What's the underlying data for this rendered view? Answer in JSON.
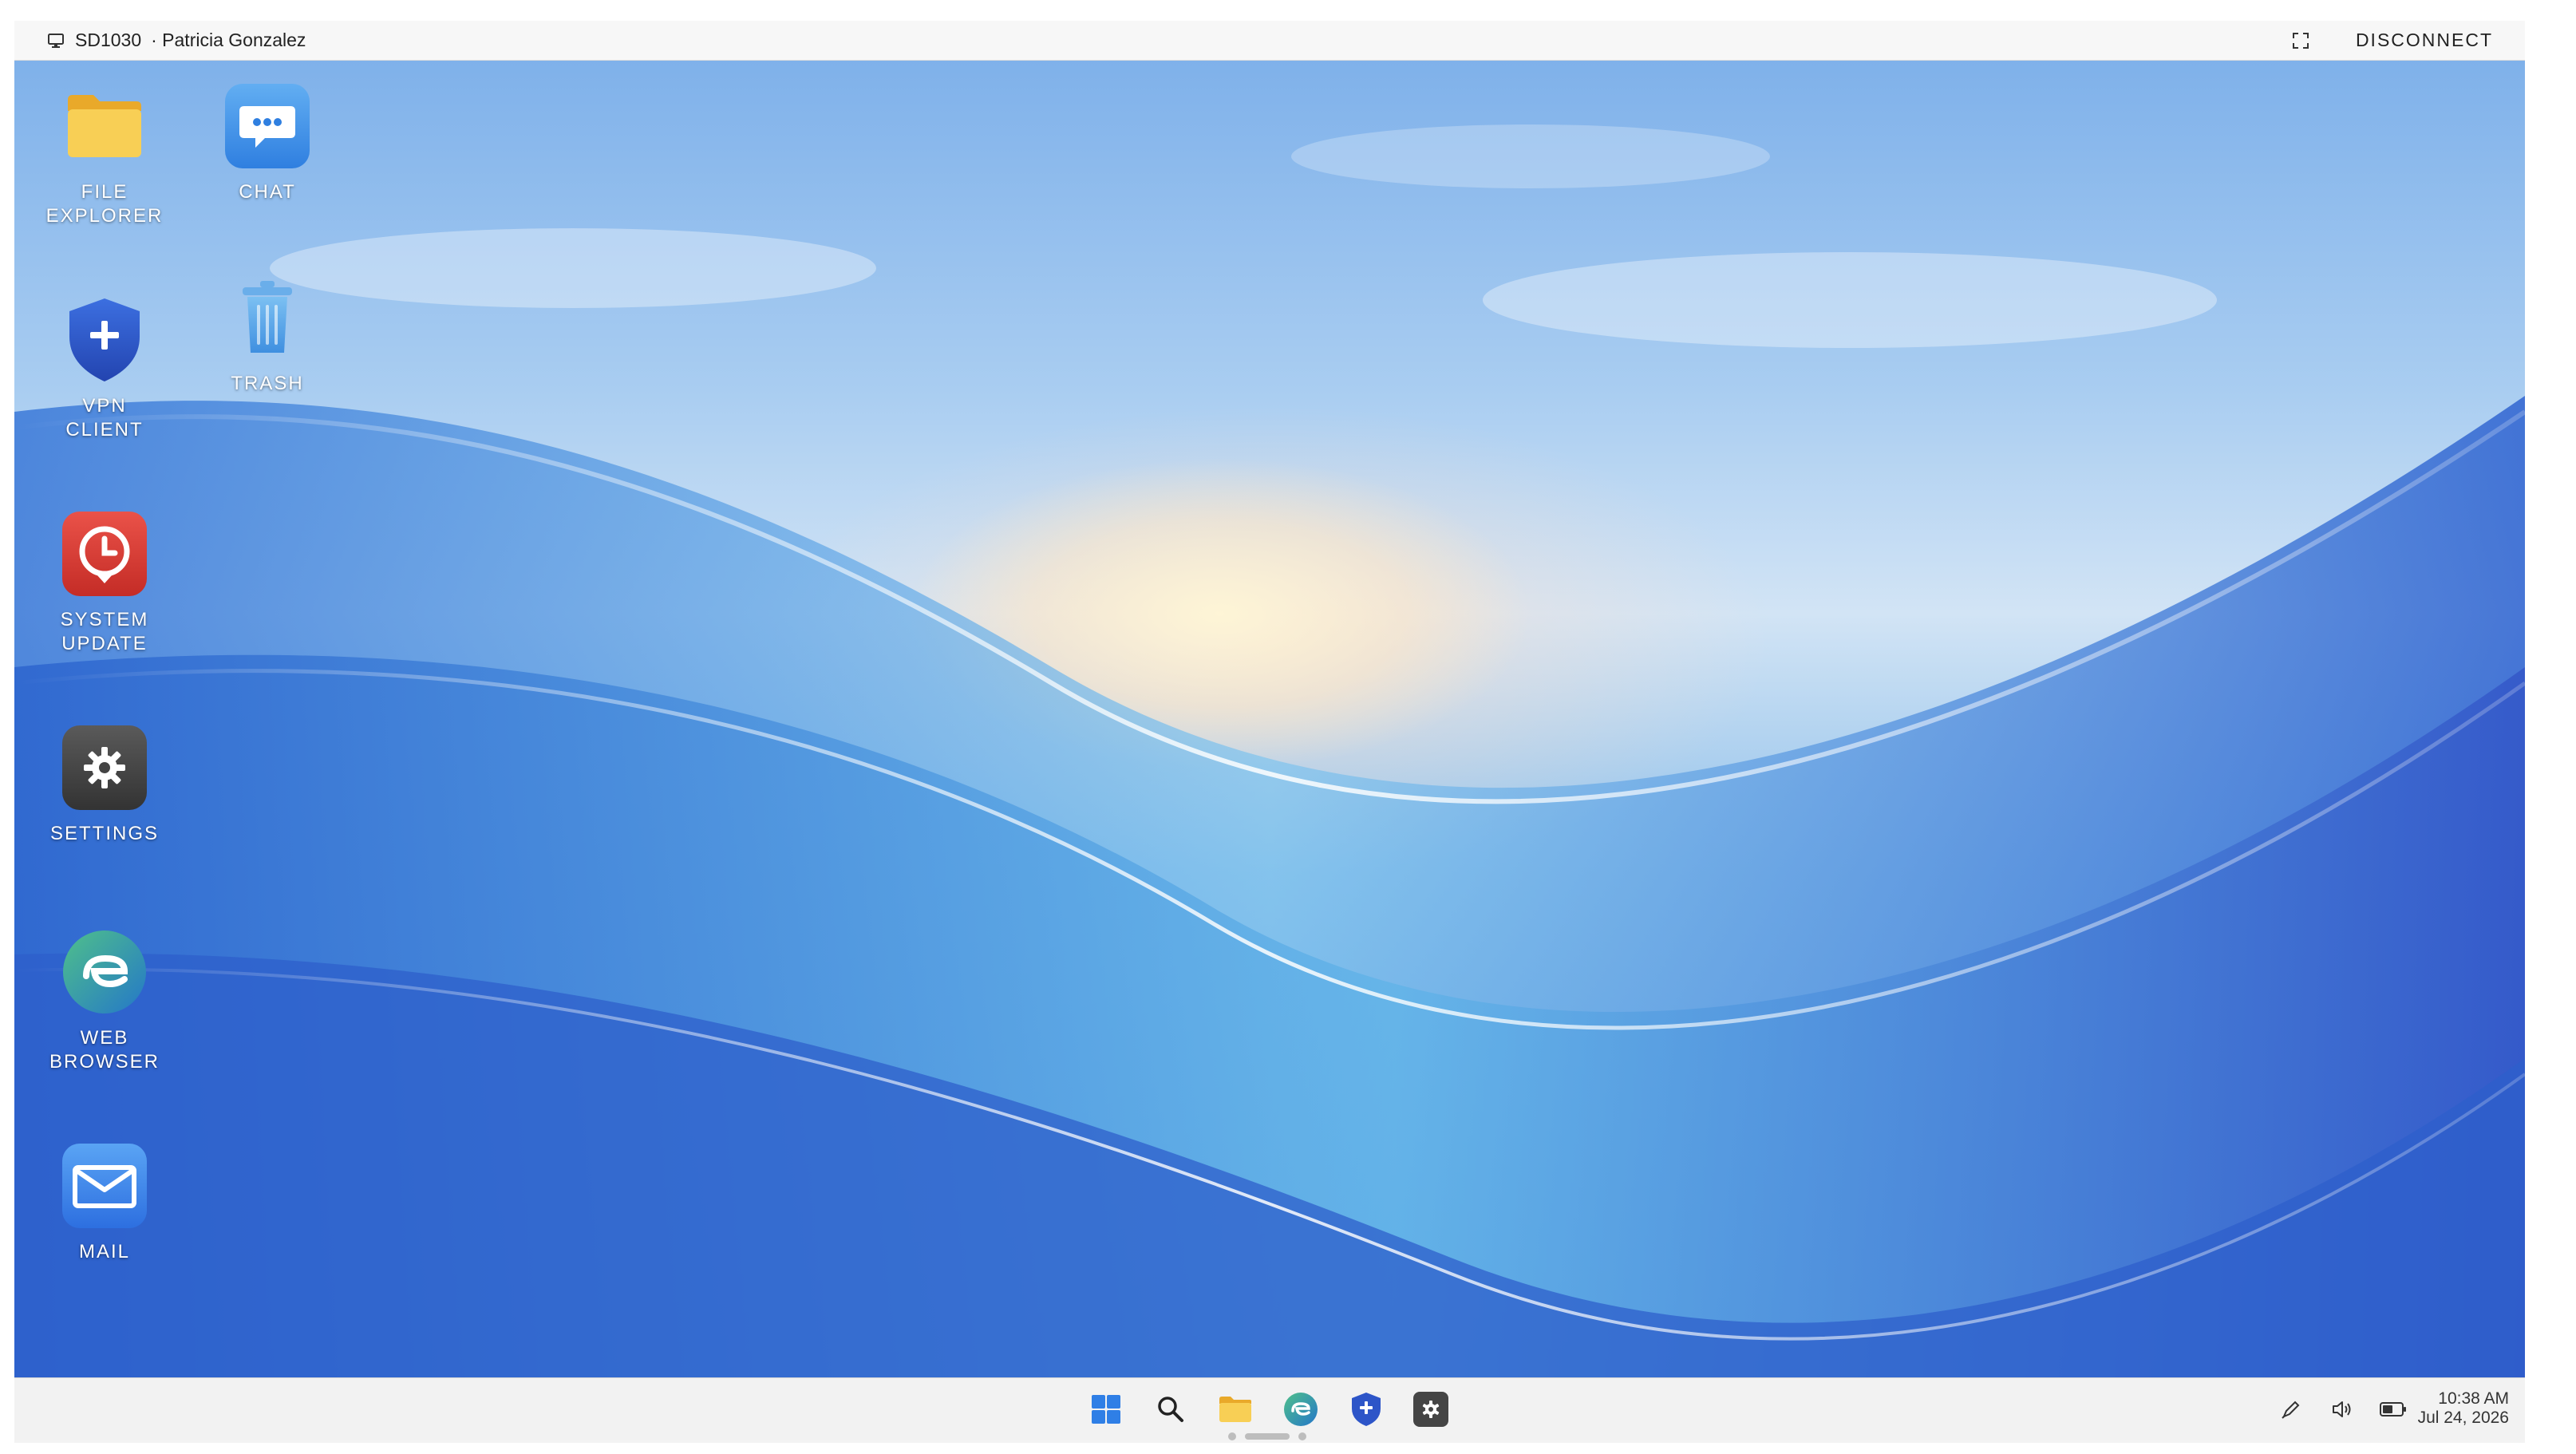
{
  "session": {
    "machine_id": "SD1030",
    "user": "· Patricia Gonzalez",
    "disconnect_label": "DISCONNECT"
  },
  "desktop_icons": [
    {
      "label": "FILE\nEXPLORER",
      "icon": "folder-icon"
    },
    {
      "label": "CHAT",
      "icon": "chat-icon"
    },
    {
      "label": "VPN\nCLIENT",
      "icon": "shield-plus-icon"
    },
    {
      "label": "TRASH",
      "icon": "trash-icon"
    },
    {
      "label": "SYSTEM\nUPDATE",
      "icon": "clock-icon"
    },
    {
      "label": "SETTINGS",
      "icon": "gear-icon"
    },
    {
      "label": "WEB\nBROWSER",
      "icon": "browser-icon"
    },
    {
      "label": "MAIL",
      "icon": "mail-icon"
    }
  ],
  "taskbar": {
    "apps": [
      "start-icon",
      "search-icon",
      "folder-icon",
      "browser-icon",
      "shield-plus-icon",
      "gear-icon"
    ],
    "tray": [
      "pen-icon",
      "volume-icon",
      "battery-icon"
    ],
    "time": "10:38 AM",
    "date": "Jul 24, 2026"
  },
  "colors": {
    "accent": "#1f6fe0",
    "folder": "#f7c843",
    "update_red": "#d93a34",
    "settings_dark": "#4a4a4a",
    "browser_teal": "#2e9ea5"
  }
}
